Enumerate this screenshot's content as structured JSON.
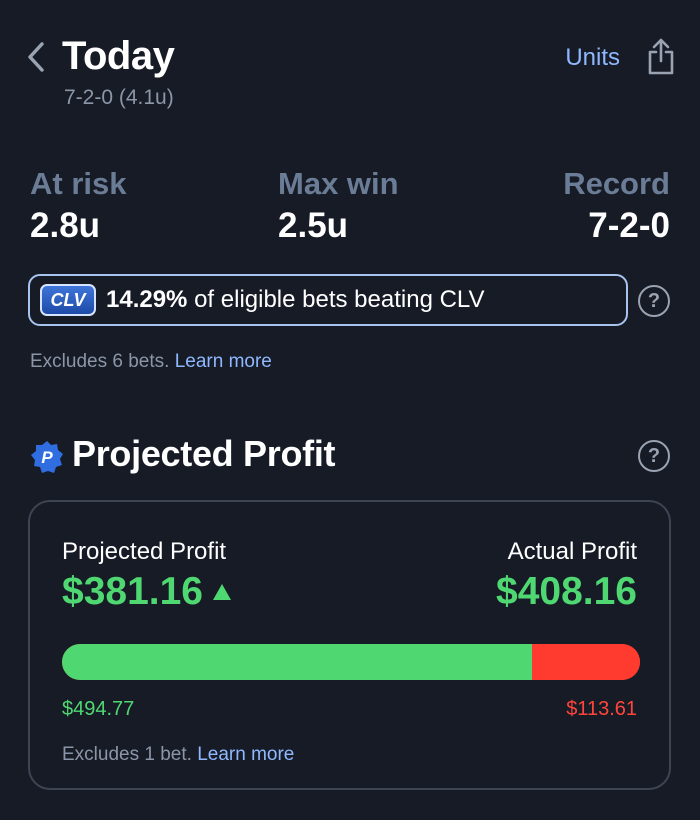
{
  "header": {
    "title": "Today",
    "subtitle": "7-2-0 (4.1u)",
    "units_label": "Units"
  },
  "stats": [
    {
      "label": "At risk",
      "value": "2.8u"
    },
    {
      "label": "Max win",
      "value": "2.5u"
    },
    {
      "label": "Record",
      "value": "7-2-0"
    }
  ],
  "clv": {
    "badge": "CLV",
    "percent": "14.29%",
    "text": " of eligible bets beating CLV",
    "note": "Excludes 6 bets.",
    "link": "Learn more"
  },
  "projected": {
    "icon_letter": "P",
    "title": "Projected Profit",
    "projected_label": "Projected Profit",
    "projected_value": "$381.16",
    "actual_label": "Actual Profit",
    "actual_value": "$408.16",
    "win_amount": "$494.77",
    "loss_amount": "$113.61",
    "win_fraction": 0.813,
    "note": "Excludes 1 bet.",
    "link": "Learn more"
  },
  "colors": {
    "background": "#161b26",
    "accent_blue": "#8fb8ff",
    "positive_green": "#4fd872",
    "negative_red": "#ff3b30"
  },
  "icons": {
    "back": "chevron-left-icon",
    "share": "share-icon",
    "help": "question-circle-icon",
    "projected": "p-badge-icon"
  }
}
